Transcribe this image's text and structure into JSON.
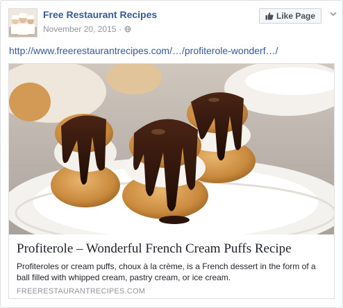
{
  "page": {
    "name": "Free Restaurant Recipes",
    "avatar_icon": "chef-group-icon"
  },
  "post": {
    "date": "November 20, 2015",
    "separator": "·",
    "audience_icon": "globe-icon",
    "link": "http://www.freerestaurantrecipes.com/…/profiterole-wonderf…/"
  },
  "actions": {
    "like_page_label": "Like Page",
    "like_icon": "thumbs-up-icon",
    "menu_icon": "chevron-down-icon"
  },
  "attachment": {
    "image_icon": "profiteroles-photo",
    "title": "Profiterole – Wonderful French Cream Puffs Recipe",
    "description": "Profiteroles or cream puffs, choux à la crème, is a French dessert in the form of a ball filled with whipped cream, pastry cream, or ice cream.",
    "domain": "FREERESTAURANTRECIPES.COM"
  },
  "colors": {
    "link": "#365899",
    "meta": "#90949c",
    "text": "#1d2129",
    "border": "#dddfe2"
  }
}
